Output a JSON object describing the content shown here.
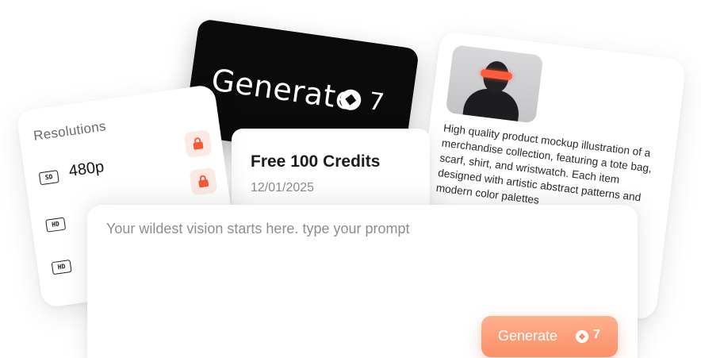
{
  "black_card": {
    "label": "Generate",
    "credit_icon": "credit-icon",
    "count": "7"
  },
  "credits_card": {
    "title": "Free 100 Credits",
    "date": "12/01/2025"
  },
  "product_card": {
    "thumbnail": "person-with-red-visor",
    "description": "High quality product mockup illustration of a merchandise collection, featuring a tote bag, scarf, shirt, and wristwatch. Each item designed with artistic abstract patterns and modern color palettes"
  },
  "resolutions": {
    "title": "Resolutions",
    "items": [
      {
        "badge": "SD",
        "label": "480p",
        "locked": true
      },
      {
        "badge": "HD",
        "label": "",
        "locked": true
      },
      {
        "badge": "HD",
        "label": "",
        "locked": false
      }
    ]
  },
  "prompt": {
    "placeholder": "Your wildest vision starts here. type your prompt",
    "value": "",
    "generate_label": "Generate",
    "credit_cost": "7"
  },
  "colors": {
    "accent": "#fb8f67",
    "lock": "#f25a38",
    "dark": "#0b0b0c"
  }
}
